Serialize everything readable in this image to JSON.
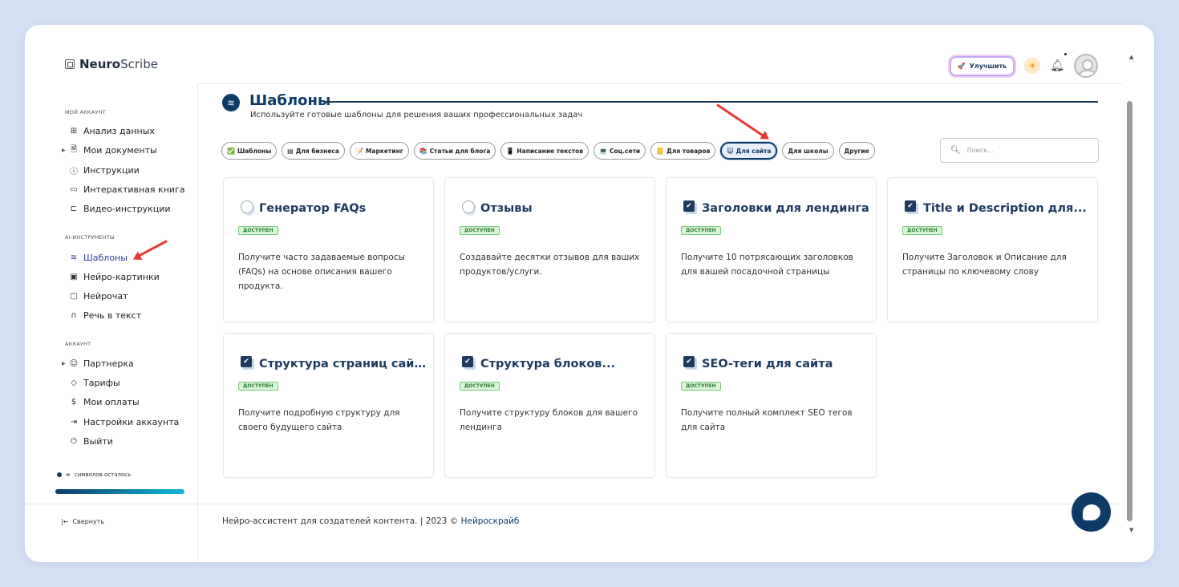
{
  "app": {
    "logo_bold": "Neuro",
    "logo_light": "Scribe"
  },
  "topbar": {
    "upgrade_label": "Улучшить"
  },
  "sidebar": {
    "sections": [
      {
        "title": "МОЙ АККАУНТ"
      },
      {
        "title": "AI-ИНСТРУМЕНТЫ"
      },
      {
        "title": "АККАУНТ"
      }
    ],
    "items": [
      {
        "label": "Анализ данных",
        "icon": "grid-icon"
      },
      {
        "label": "Мои документы",
        "icon": "document-icon"
      },
      {
        "label": "Инструкции",
        "icon": "help-icon"
      },
      {
        "label": "Интерактивная книга",
        "icon": "book-icon"
      },
      {
        "label": "Видео-инструкции",
        "icon": "video-icon"
      },
      {
        "label": "Шаблоны",
        "icon": "layers-icon"
      },
      {
        "label": "Нейро-картинки",
        "icon": "image-icon"
      },
      {
        "label": "Нейрочат",
        "icon": "chat-icon"
      },
      {
        "label": "Речь в текст",
        "icon": "headphones-icon"
      },
      {
        "label": "Партнерка",
        "icon": "users-icon"
      },
      {
        "label": "Тарифы",
        "icon": "tag-icon"
      },
      {
        "label": "Мои оплаты",
        "icon": "dollar-icon"
      },
      {
        "label": "Настройки аккаунта",
        "icon": "settings-icon"
      },
      {
        "label": "Выйти",
        "icon": "power-icon"
      }
    ],
    "symbols_symbol": "∞",
    "symbols_label": "символов осталось",
    "symbols_fill_fraction": 1.0,
    "collapse_label": "Свернуть"
  },
  "main": {
    "title": "Шаблоны",
    "subtitle": "Используйте готовые шаблоны для решения ваших профессиональных задач",
    "chips": [
      {
        "label": "Шаблоны",
        "icon": "✅"
      },
      {
        "label": "Для бизнеса",
        "icon": "▤"
      },
      {
        "label": "Маркетинг",
        "icon": "📝"
      },
      {
        "label": "Статьи для блога",
        "icon": "📚"
      },
      {
        "label": "Написание текстов",
        "icon": "📱"
      },
      {
        "label": "Соц.сети",
        "icon": "💻"
      },
      {
        "label": "Для товаров",
        "icon": "📒"
      },
      {
        "label": "Для сайта",
        "icon": "😺",
        "active": true
      },
      {
        "label": "Для школы",
        "icon": ""
      },
      {
        "label": "Другие",
        "icon": ""
      }
    ],
    "search_placeholder": "Поиск...",
    "badge_label": "ДОСТУПЕН",
    "cards": [
      {
        "title": "Генератор FAQs",
        "desc": "Получите часто задаваемые вопросы (FAQs) на основе описания вашего продукта.",
        "icon": "bubble"
      },
      {
        "title": "Отзывы",
        "desc": "Создавайте десятки отзывов для ваших продуктов/услуги.",
        "icon": "bubble"
      },
      {
        "title": "Заголовки для лендинга",
        "desc": "Получите 10 потрясающих заголовков для вашей посадочной страницы",
        "icon": "check"
      },
      {
        "title": "Title и Description для...",
        "desc": "Получите Заголовок и Описание для страницы по ключевому слову",
        "icon": "check"
      },
      {
        "title": "Структура страниц сайта",
        "desc": "Получите подробную структуру для своего будущего сайта",
        "icon": "check"
      },
      {
        "title": "Структура блоков...",
        "desc": "Получите структуру блоков для вашего лендинга",
        "icon": "check"
      },
      {
        "title": "SEO-теги для сайта",
        "desc": "Получите полный комплект SEO тегов для сайта",
        "icon": "check"
      }
    ]
  },
  "footer": {
    "text": "Нейро-ассистент для создателей контента.  | 2023 © ",
    "brand": "Нейроскрайб"
  }
}
